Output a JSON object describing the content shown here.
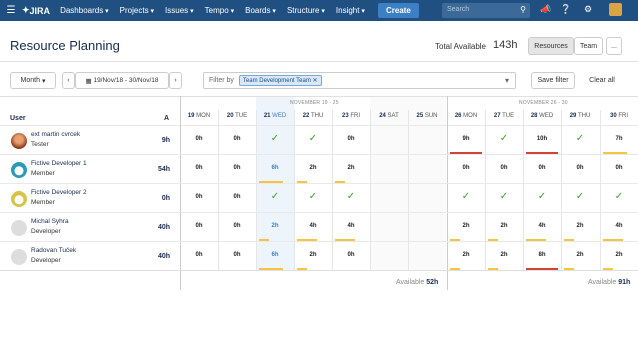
{
  "nav": {
    "logo": "JIRA",
    "items": [
      "Dashboards",
      "Projects",
      "Issues",
      "Tempo",
      "Boards",
      "Structure",
      "Insight"
    ],
    "create": "Create",
    "search_placeholder": "Search"
  },
  "header": {
    "title": "Resource Planning",
    "total_label": "Total Available",
    "total_value": "143h",
    "resources_btn": "Resources",
    "team_btn": "Team",
    "more_btn": "..."
  },
  "toolbar": {
    "month": "Month",
    "date_range": "19/Nov/18 - 30/Nov/18",
    "filter_label": "Filter by",
    "filter_tag": "Team Development Team",
    "save_filter": "Save filter",
    "clear_all": "Clear all"
  },
  "grid": {
    "user_header": "User",
    "a_header": "A",
    "weeks": [
      "NOVEMBER 19 - 25",
      "NOVEMBER 26 - 30"
    ],
    "days": [
      {
        "num": "19",
        "name": "MON"
      },
      {
        "num": "20",
        "name": "TUE"
      },
      {
        "num": "21",
        "name": "WED"
      },
      {
        "num": "22",
        "name": "THU"
      },
      {
        "num": "23",
        "name": "FRI"
      },
      {
        "num": "24",
        "name": "SAT"
      },
      {
        "num": "25",
        "name": "SUN"
      },
      {
        "num": "26",
        "name": "MON"
      },
      {
        "num": "27",
        "name": "TUE"
      },
      {
        "num": "28",
        "name": "WED"
      },
      {
        "num": "29",
        "name": "THU"
      },
      {
        "num": "30",
        "name": "FRI"
      }
    ],
    "users": [
      {
        "name": "ext martin cvrcek",
        "role": "Tester",
        "hours": "9h",
        "cells": [
          "0h",
          "0h",
          "✓",
          "✓",
          "0h",
          "",
          "",
          "9h",
          "✓",
          "10h",
          "✓",
          "7h"
        ],
        "bars": [
          "",
          "",
          "",
          "",
          "",
          "",
          "",
          "red",
          "",
          "red",
          "",
          "yellow"
        ]
      },
      {
        "name": "Fictive Developer 1",
        "role": "Member",
        "hours": "54h",
        "cells": [
          "0h",
          "0h",
          "6h",
          "2h",
          "2h",
          "",
          "",
          "0h",
          "0h",
          "0h",
          "0h",
          "0h"
        ],
        "bars": [
          "",
          "",
          "yellow",
          "yellow",
          "yellow",
          "",
          "",
          "",
          "",
          "",
          "",
          ""
        ]
      },
      {
        "name": "Fictive Developer 2",
        "role": "Member",
        "hours": "0h",
        "cells": [
          "0h",
          "0h",
          "✓",
          "✓",
          "✓",
          "",
          "",
          "✓",
          "✓",
          "✓",
          "✓",
          "✓"
        ],
        "bars": [
          "",
          "",
          "",
          "",
          "",
          "",
          "",
          "",
          "",
          "",
          "",
          ""
        ]
      },
      {
        "name": "Michal Syhra",
        "role": "Developer",
        "hours": "40h",
        "cells": [
          "0h",
          "0h",
          "2h",
          "4h",
          "4h",
          "",
          "",
          "2h",
          "2h",
          "4h",
          "2h",
          "4h"
        ],
        "bars": [
          "",
          "",
          "yellow",
          "yellow",
          "yellow",
          "",
          "",
          "yellow",
          "yellow",
          "yellow",
          "yellow",
          "yellow"
        ]
      },
      {
        "name": "Radovan Tuček",
        "role": "Developer",
        "hours": "40h",
        "cells": [
          "0h",
          "0h",
          "6h",
          "2h",
          "0h",
          "",
          "",
          "2h",
          "2h",
          "8h",
          "2h",
          "2h"
        ],
        "bars": [
          "",
          "",
          "yellow",
          "yellow",
          "",
          "",
          "",
          "yellow",
          "yellow",
          "red",
          "yellow",
          "yellow"
        ]
      }
    ],
    "available": [
      {
        "label": "Available",
        "value": "52h"
      },
      {
        "label": "Available",
        "value": "91h"
      }
    ]
  },
  "colors": {
    "nav": "#205081",
    "check": "#3c9e2a",
    "red": "#d04437",
    "yellow": "#f6c342"
  }
}
